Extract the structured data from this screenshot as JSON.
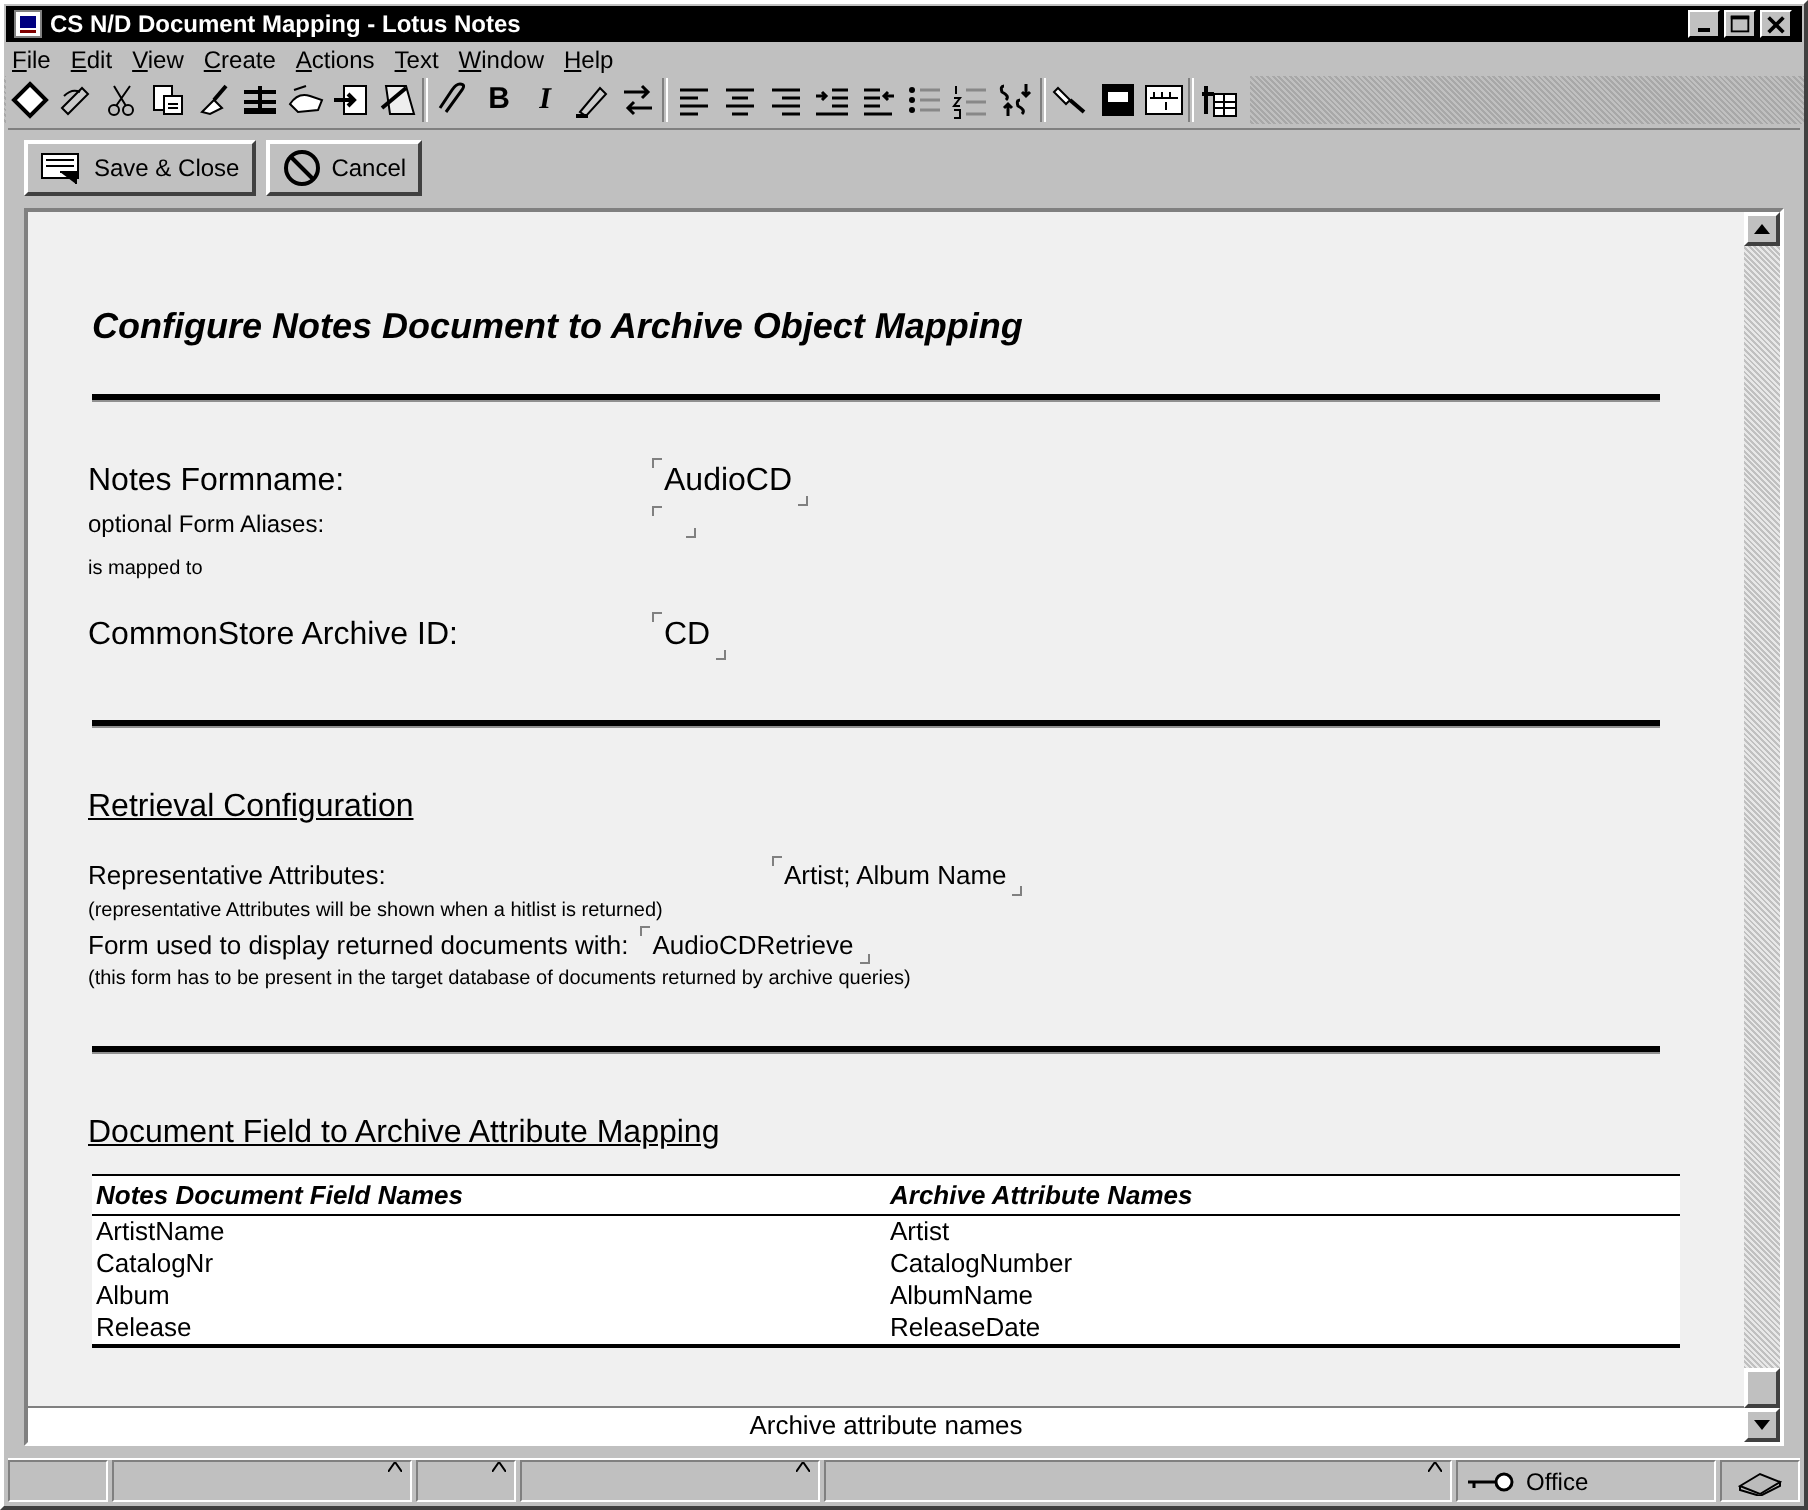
{
  "window": {
    "title": "CS N/D Document Mapping - Lotus Notes"
  },
  "menu": [
    "File",
    "Edit",
    "View",
    "Create",
    "Actions",
    "Text",
    "Window",
    "Help"
  ],
  "toolbar": {
    "bold_label": "B",
    "italic_label": "I"
  },
  "action_bar": [
    {
      "kind": "save",
      "label": "Save & Close"
    },
    {
      "kind": "cancel",
      "label": "Cancel"
    }
  ],
  "document": {
    "heading": "Configure Notes Document to Archive Object Mapping",
    "formname": {
      "label": "Notes Formname:",
      "value": "AudioCD"
    },
    "aliases": {
      "label": "optional Form Aliases:"
    },
    "mapped_note": "is mapped to",
    "archive_id": {
      "label": "CommonStore Archive ID:",
      "value": "CD"
    },
    "retrieval": {
      "heading": "Retrieval Configuration",
      "attributes": {
        "label": "Representative Attributes:",
        "value": "Artist; Album Name"
      },
      "attributes_note": "(representative Attributes will be shown when a hitlist is returned)",
      "form": {
        "label": "Form used to display returned documents with:",
        "value": "AudioCDRetrieve"
      },
      "form_note": "(this form has to be present in the target database of documents returned by archive queries)"
    },
    "mapping": {
      "heading": "Document Field to Archive Attribute Mapping",
      "columns": [
        "Notes Document Field Names",
        "Archive Attribute Names"
      ],
      "rows": [
        [
          "ArtistName",
          "Artist"
        ],
        [
          "CatalogNr",
          "CatalogNumber"
        ],
        [
          "Album",
          "AlbumName"
        ],
        [
          "Release",
          "ReleaseDate"
        ]
      ]
    }
  },
  "field_help": "Archive attribute names",
  "status_bar": {
    "location": "Office"
  }
}
